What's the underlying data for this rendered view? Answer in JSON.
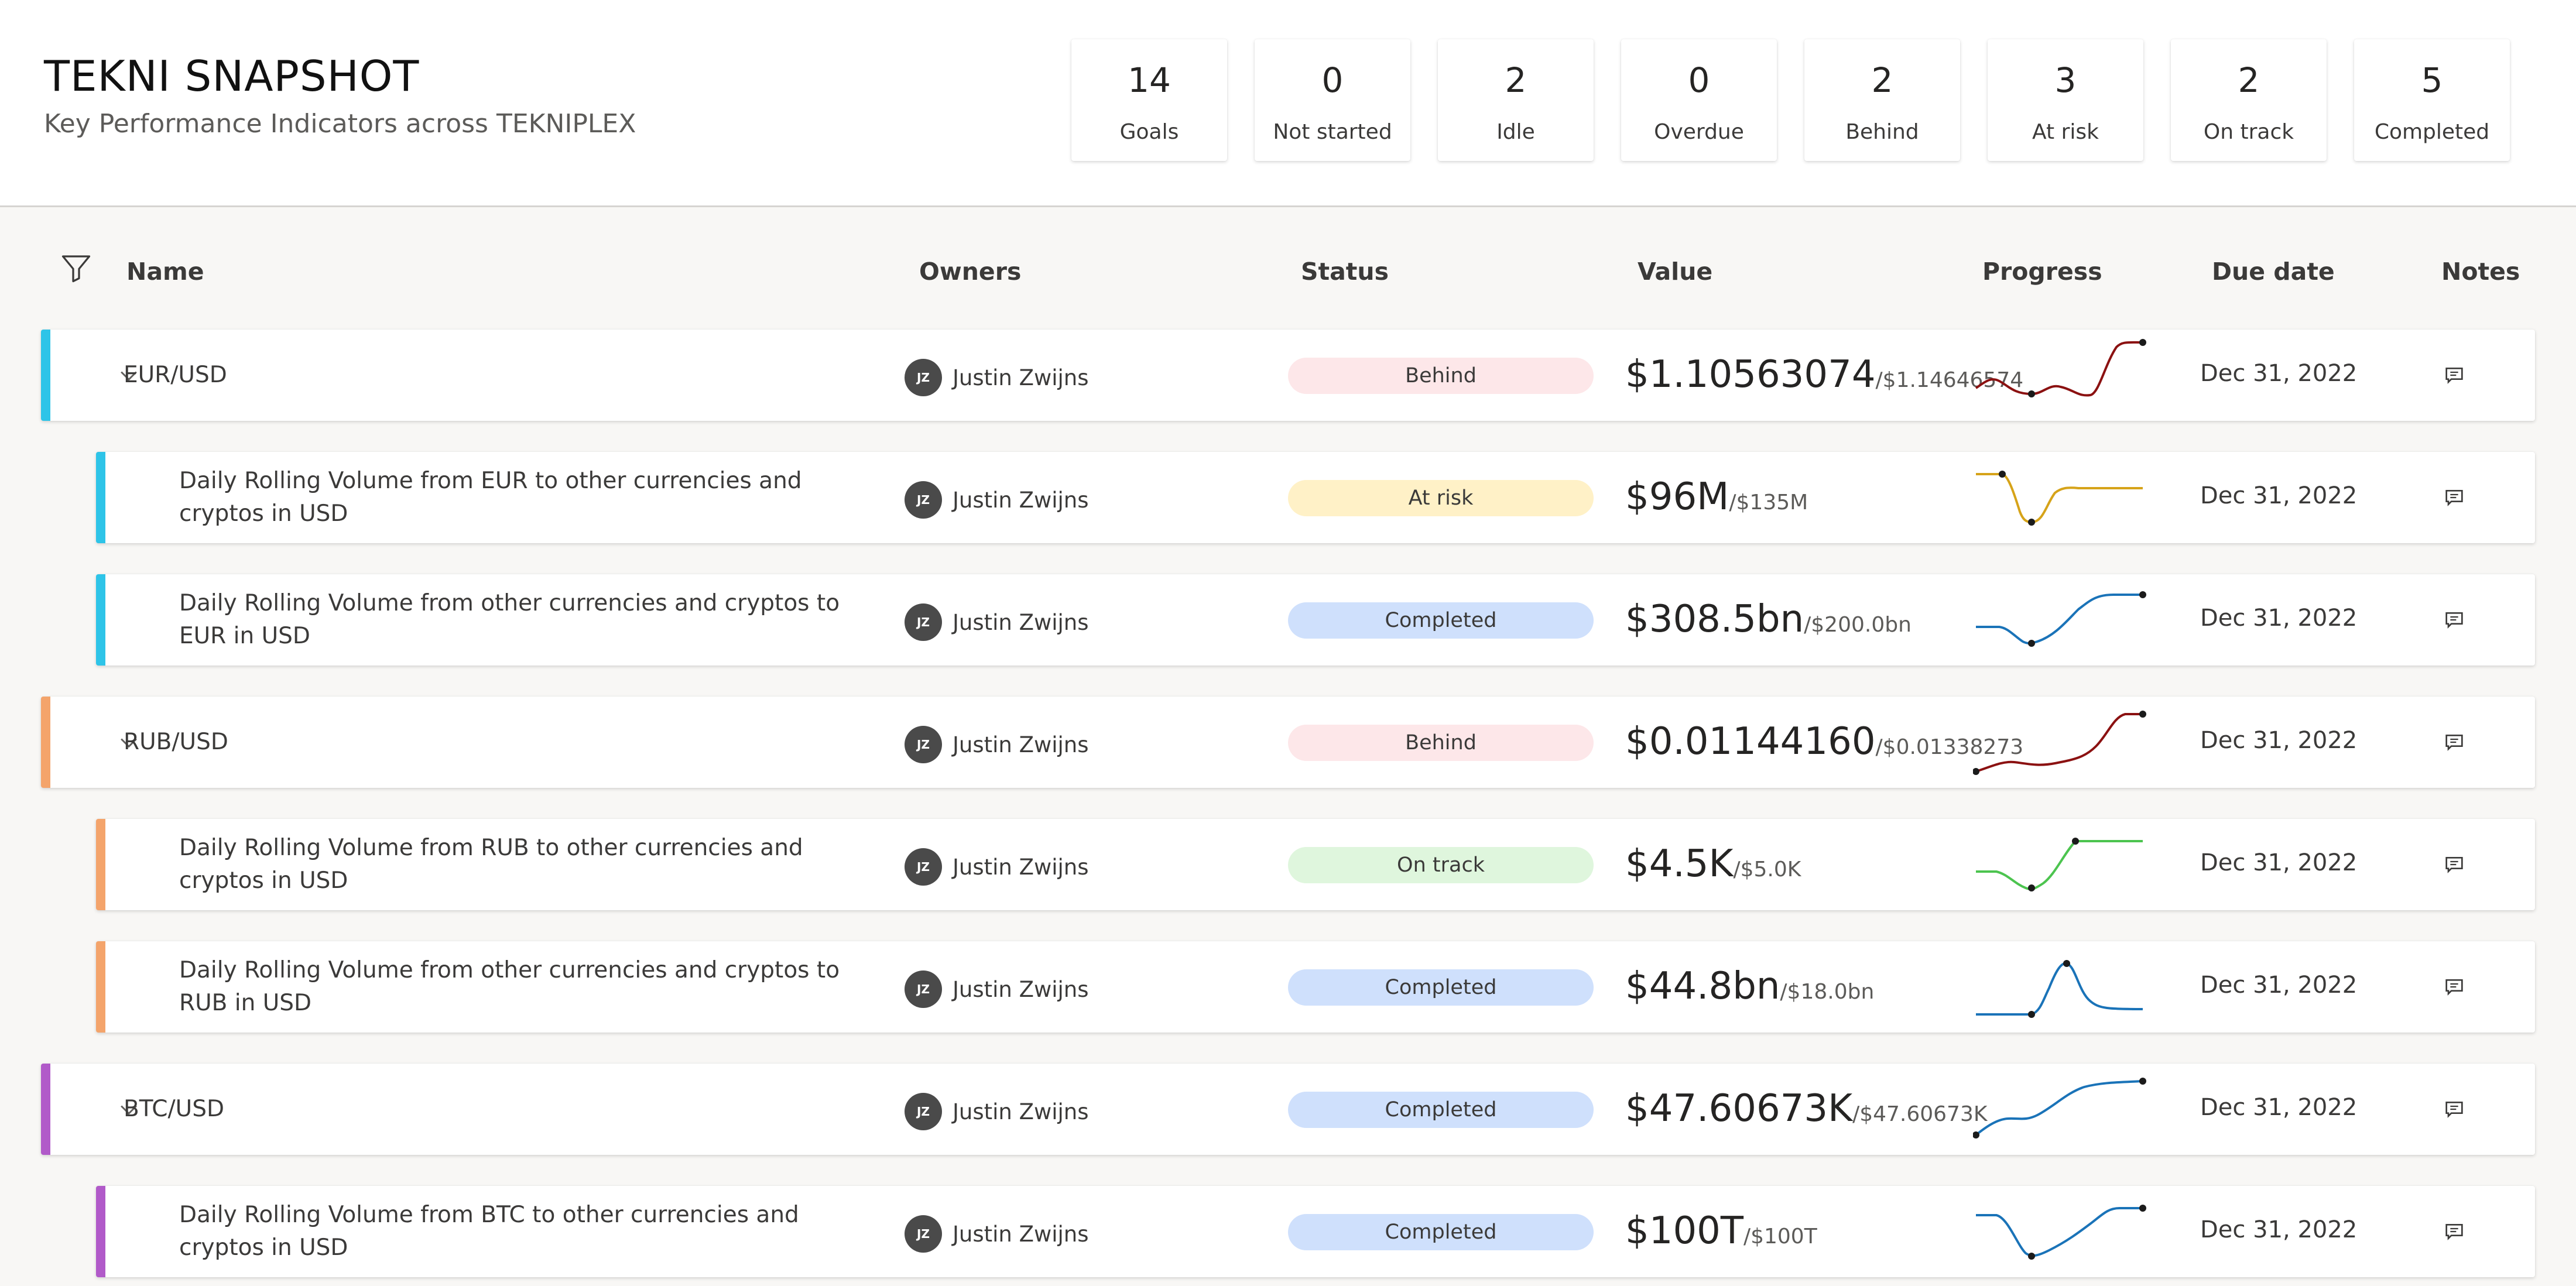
{
  "header": {
    "title": "TEKNI SNAPSHOT",
    "subtitle": "Key Performance Indicators across TEKNIPLEX",
    "kpis": [
      {
        "value": "14",
        "label": "Goals"
      },
      {
        "value": "0",
        "label": "Not started"
      },
      {
        "value": "2",
        "label": "Idle"
      },
      {
        "value": "0",
        "label": "Overdue"
      },
      {
        "value": "2",
        "label": "Behind"
      },
      {
        "value": "3",
        "label": "At risk"
      },
      {
        "value": "2",
        "label": "On track"
      },
      {
        "value": "5",
        "label": "Completed"
      }
    ]
  },
  "columns": {
    "name": "Name",
    "owners": "Owners",
    "status": "Status",
    "value": "Value",
    "progress": "Progress",
    "due": "Due date",
    "notes": "Notes"
  },
  "icons": {
    "filter": "filter-icon",
    "expand": "chevron-down-icon",
    "notes": "comment-icon"
  },
  "status_colors": {
    "Behind": "#fde7e9",
    "At risk": "#fff1c7",
    "Completed": "#cfe0fc",
    "On track": "#dff6dd"
  },
  "goals": [
    {
      "level": "parent",
      "name": "EUR/USD",
      "accent": "#2ec4e8",
      "owner_initials": "JZ",
      "owner": "Justin Zwijns",
      "status": "Behind",
      "value": "$1.10563074",
      "target": "/$1.14646574",
      "due": "Dec 31, 2022",
      "spark_color": "#8b1111"
    },
    {
      "level": "child",
      "name": "Daily Rolling Volume from EUR to other currencies and cryptos in USD",
      "accent": "#2ec4e8",
      "owner_initials": "JZ",
      "owner": "Justin Zwijns",
      "status": "At risk",
      "value": "$96M",
      "target": "/$135M",
      "due": "Dec 31, 2022",
      "spark_color": "#d6a319"
    },
    {
      "level": "child",
      "name": "Daily Rolling Volume from other currencies and cryptos to EUR in USD",
      "accent": "#2ec4e8",
      "owner_initials": "JZ",
      "owner": "Justin Zwijns",
      "status": "Completed",
      "value": "$308.5bn",
      "target": "/$200.0bn",
      "due": "Dec 31, 2022",
      "spark_color": "#1a73b8"
    },
    {
      "level": "parent",
      "name": "RUB/USD",
      "accent": "#f4a46b",
      "owner_initials": "JZ",
      "owner": "Justin Zwijns",
      "status": "Behind",
      "value": "$0.01144160",
      "target": "/$0.01338273",
      "due": "Dec 31, 2022",
      "spark_color": "#8b1111"
    },
    {
      "level": "child",
      "name": "Daily Rolling Volume from RUB to other currencies and cryptos in USD",
      "accent": "#f4a46b",
      "owner_initials": "JZ",
      "owner": "Justin Zwijns",
      "status": "On track",
      "value": "$4.5K",
      "target": "/$5.0K",
      "due": "Dec 31, 2022",
      "spark_color": "#4cc44f"
    },
    {
      "level": "child",
      "name": "Daily Rolling Volume from other currencies and cryptos to RUB in USD",
      "accent": "#f4a46b",
      "owner_initials": "JZ",
      "owner": "Justin Zwijns",
      "status": "Completed",
      "value": "$44.8bn",
      "target": "/$18.0bn",
      "due": "Dec 31, 2022",
      "spark_color": "#1a73b8"
    },
    {
      "level": "parent",
      "name": "BTC/USD",
      "accent": "#b15ac9",
      "owner_initials": "JZ",
      "owner": "Justin Zwijns",
      "status": "Completed",
      "value": "$47.60673K",
      "target": "/$47.60673K",
      "due": "Dec 31, 2022",
      "spark_color": "#1a73b8"
    },
    {
      "level": "child",
      "name": "Daily Rolling Volume from BTC to other currencies and cryptos in USD",
      "accent": "#b15ac9",
      "owner_initials": "JZ",
      "owner": "Justin Zwijns",
      "status": "Completed",
      "value": "$100T",
      "target": "/$100T",
      "due": "Dec 31, 2022",
      "spark_color": "#1a73b8"
    }
  ]
}
